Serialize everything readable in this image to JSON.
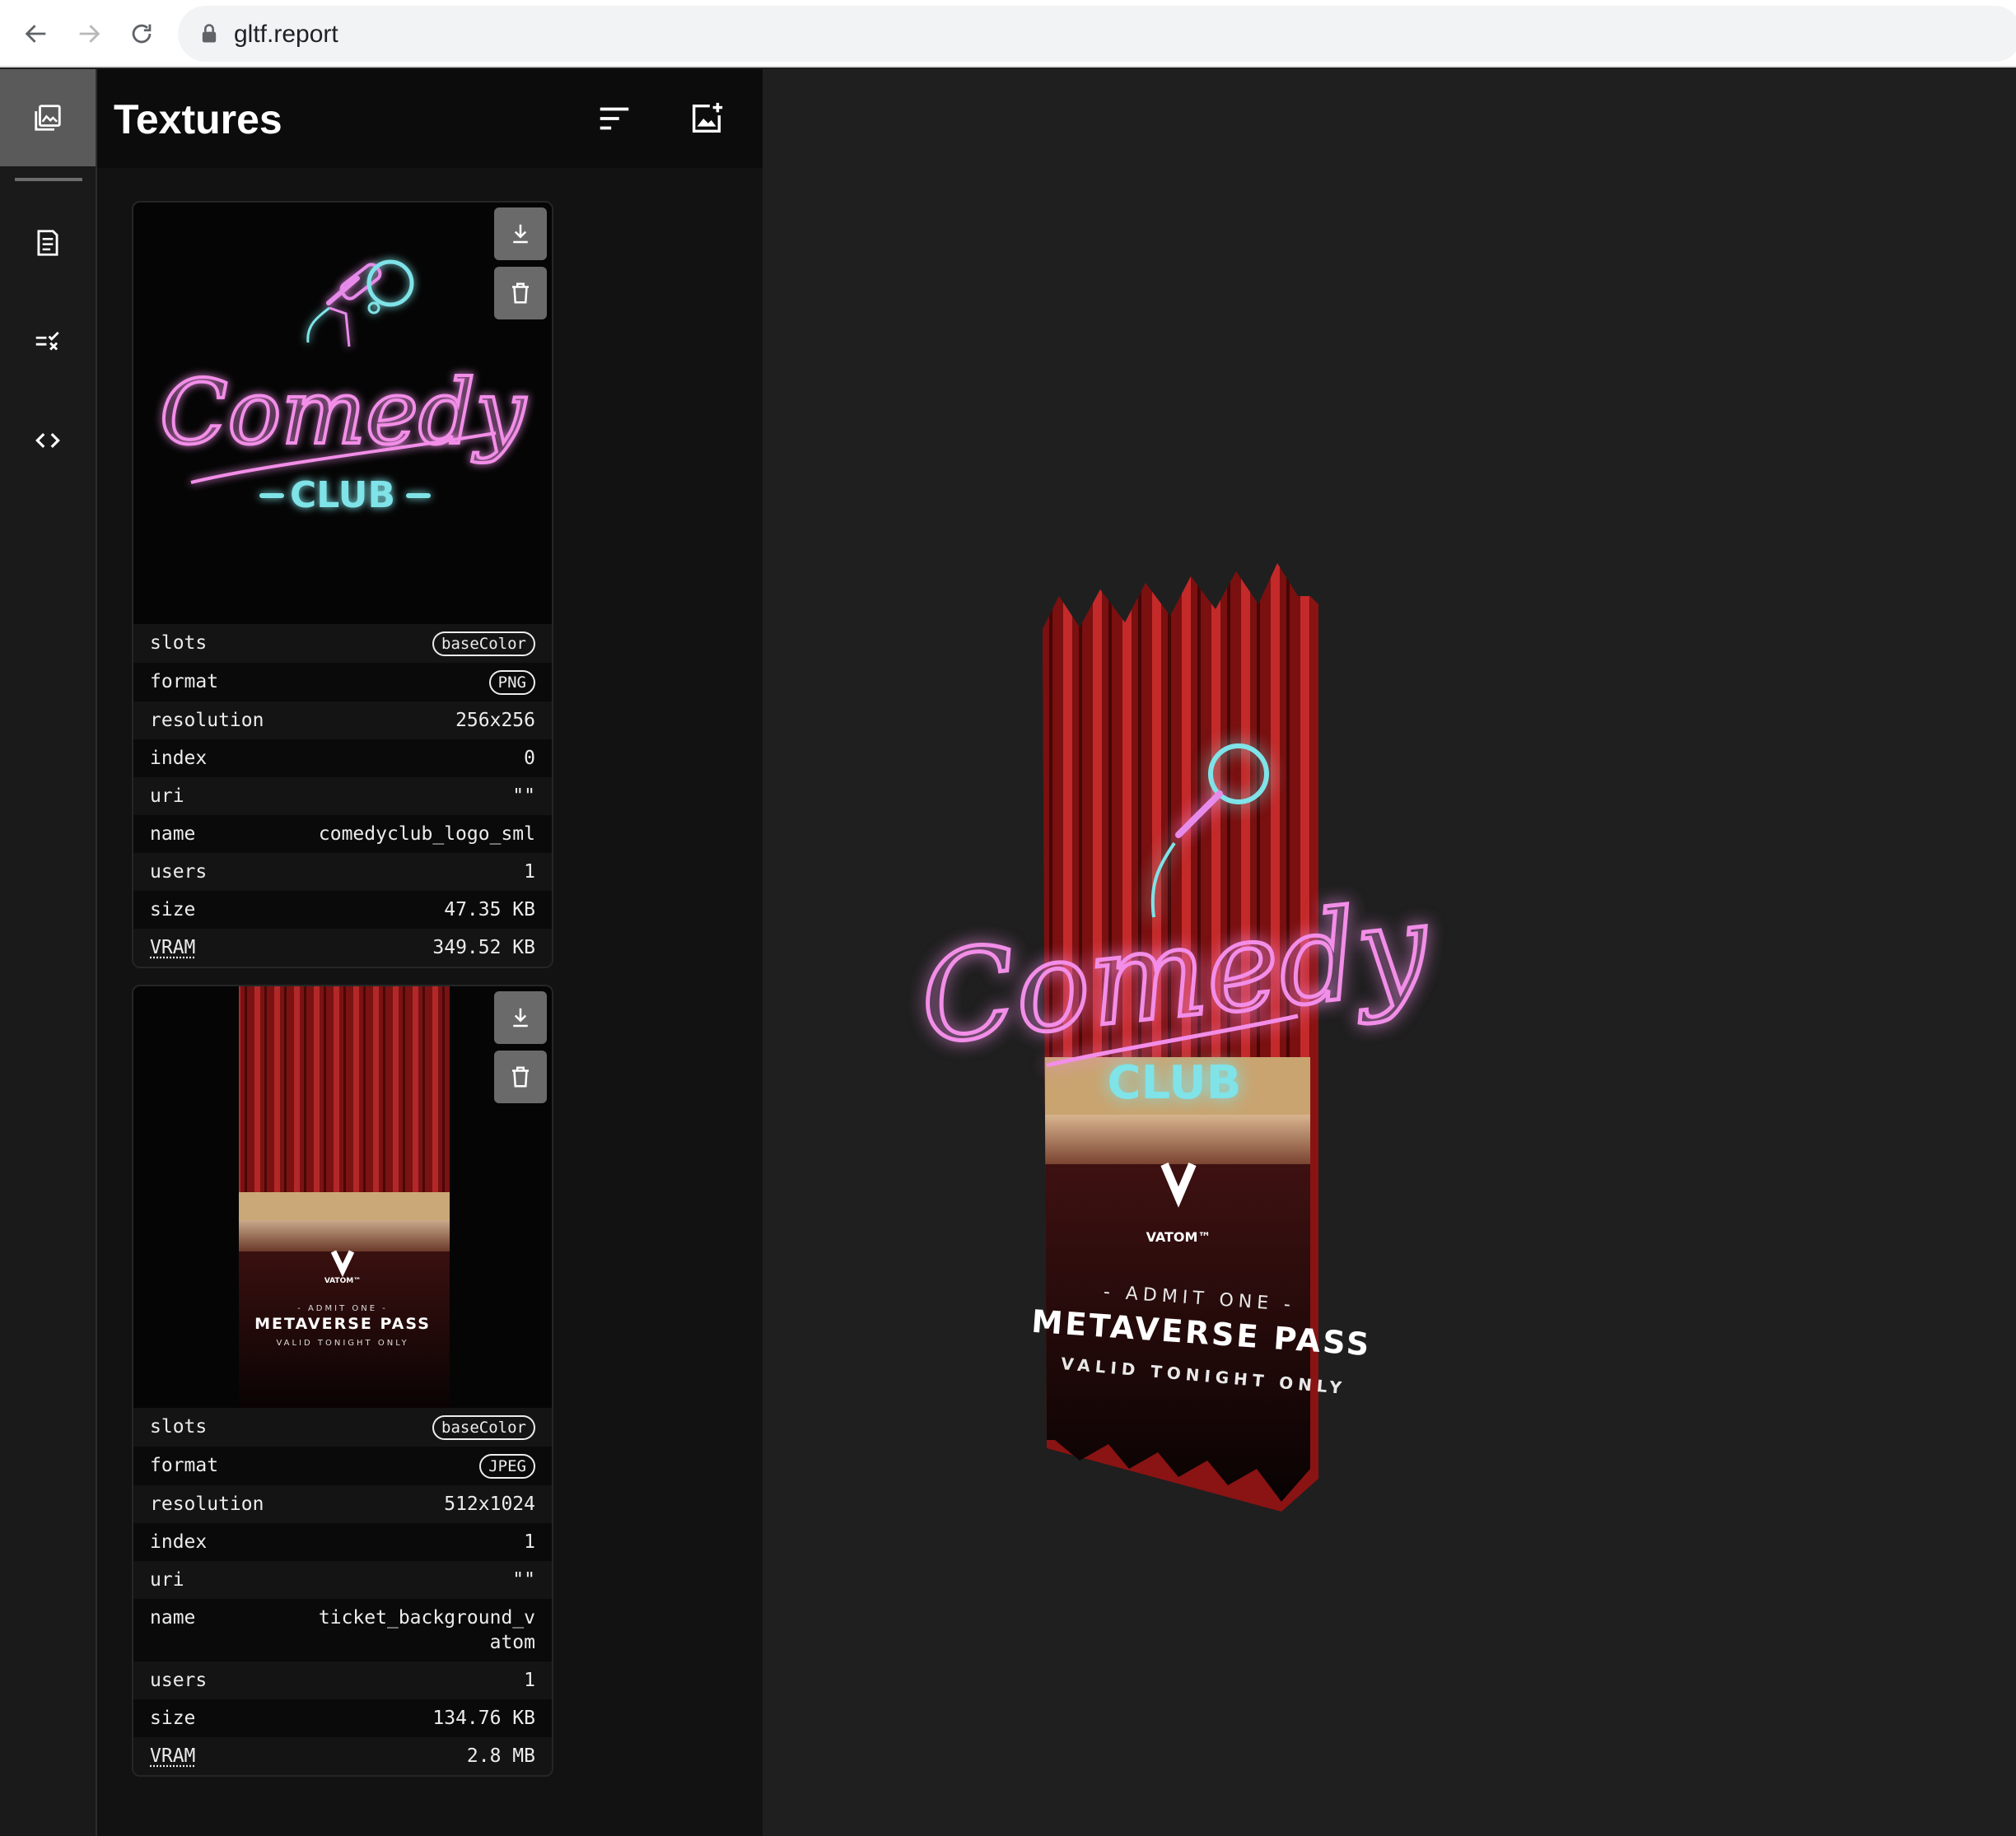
{
  "browser": {
    "url": "gltf.report"
  },
  "icons": {
    "back": "arrow-left-icon",
    "forward": "arrow-right-icon",
    "reload": "reload-icon",
    "lock": "lock-icon",
    "rail": [
      "textures-icon",
      "document-icon",
      "checklist-icon",
      "code-icon"
    ],
    "header": [
      "sort-icon",
      "add-image-icon"
    ],
    "card": [
      "download-icon",
      "trash-icon"
    ]
  },
  "panel": {
    "title": "Textures"
  },
  "textures": [
    {
      "preview": {
        "script_word": "Comedy",
        "sub_word": "CLUB"
      },
      "props": [
        {
          "key": "slots",
          "value": "baseColor",
          "badge": true
        },
        {
          "key": "format",
          "value": "PNG",
          "badge": true
        },
        {
          "key": "resolution",
          "value": "256x256"
        },
        {
          "key": "index",
          "value": "0"
        },
        {
          "key": "uri",
          "value": "\"\""
        },
        {
          "key": "name",
          "value": "comedyclub_logo_sml"
        },
        {
          "key": "users",
          "value": "1"
        },
        {
          "key": "size",
          "value": "47.35 KB"
        },
        {
          "key": "VRAM",
          "value": "349.52 KB",
          "abbr": true
        }
      ]
    },
    {
      "preview": {
        "brand": "VATOM™",
        "admit": "- ADMIT ONE -",
        "pass": "METAVERSE PASS",
        "valid": "VALID TONIGHT ONLY"
      },
      "props": [
        {
          "key": "slots",
          "value": "baseColor",
          "badge": true
        },
        {
          "key": "format",
          "value": "JPEG",
          "badge": true
        },
        {
          "key": "resolution",
          "value": "512x1024"
        },
        {
          "key": "index",
          "value": "1"
        },
        {
          "key": "uri",
          "value": "\"\""
        },
        {
          "key": "name",
          "value": "ticket_background_vatom"
        },
        {
          "key": "users",
          "value": "1"
        },
        {
          "key": "size",
          "value": "134.76 KB"
        },
        {
          "key": "VRAM",
          "value": "2.8 MB",
          "abbr": true
        }
      ]
    }
  ],
  "viewport": {
    "ticket": {
      "script_word": "Comedy",
      "sub_word": "CLUB",
      "brand": "VATOM™",
      "admit": "- ADMIT ONE -",
      "pass": "METAVERSE PASS",
      "valid": "VALID TONIGHT ONLY"
    }
  },
  "colors": {
    "accent_pink": "#f06bd8",
    "accent_cyan": "#7fe3e8",
    "curtain_red": "#8e1414"
  }
}
